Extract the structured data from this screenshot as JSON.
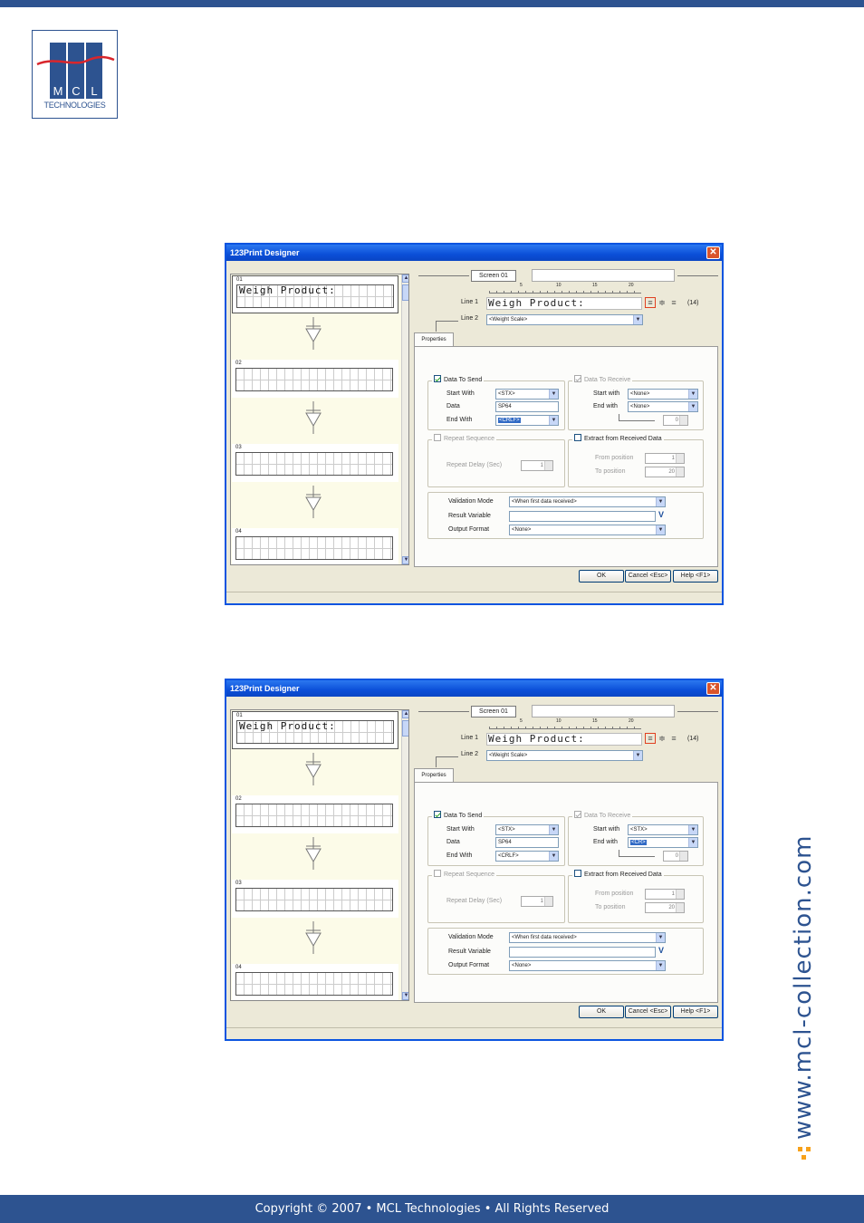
{
  "header": {
    "bar_color": "#2d5390"
  },
  "logo": {
    "letters": "M C L",
    "sub": "TECHNOLOGIES"
  },
  "side_url": "www.mcl-collection.com",
  "footer": {
    "text": "Copyright © 2007 • MCL Technologies • All Rights Reserved"
  },
  "windows": [
    {
      "title": "123Print Designer",
      "screens": [
        {
          "num": "01",
          "text": "Weigh Product:"
        },
        {
          "num": "02",
          "text": ""
        },
        {
          "num": "03",
          "text": ""
        },
        {
          "num": "04",
          "text": ""
        }
      ],
      "screen_btn": "Screen 01",
      "ruler": [
        "5",
        "10",
        "15",
        "20"
      ],
      "line1_label": "Line 1",
      "line1_value": "Weigh Product:",
      "line1_count": "(14)",
      "line2_label": "Line 2",
      "line2_value": "<Weight Scale>",
      "tab": "Properties",
      "send": {
        "title": "Data To Send",
        "start_label": "Start With",
        "start_value": "<STX>",
        "data_label": "Data",
        "data_value": "SP64",
        "end_label": "End With",
        "end_value": "<CRLF>",
        "end_highlight": true
      },
      "receive": {
        "title": "Data To Receive",
        "start_label": "Start with",
        "start_value": "<None>",
        "end_label": "End with",
        "end_value": "<None>",
        "end_highlight": false,
        "spin": "0"
      },
      "repeat": {
        "title": "Repeat Sequence",
        "delay_label": "Repeat Delay (Sec)",
        "delay_value": "1"
      },
      "extract": {
        "title": "Extract from Received Data",
        "from_label": "From position",
        "from_value": "1",
        "to_label": "To position",
        "to_value": "20"
      },
      "validation": {
        "mode_label": "Validation Mode",
        "mode_value": "<When first data received>",
        "result_label": "Result Variable",
        "result_value": "",
        "output_label": "Output Format",
        "output_value": "<None>"
      },
      "buttons": {
        "ok": "OK",
        "cancel": "Cancel <Esc>",
        "help": "Help <F1>"
      }
    },
    {
      "title": "123Print Designer",
      "screens": [
        {
          "num": "01",
          "text": "Weigh Product:"
        },
        {
          "num": "02",
          "text": ""
        },
        {
          "num": "03",
          "text": ""
        },
        {
          "num": "04",
          "text": ""
        }
      ],
      "screen_btn": "Screen 01",
      "ruler": [
        "5",
        "10",
        "15",
        "20"
      ],
      "line1_label": "Line 1",
      "line1_value": "Weigh Product:",
      "line1_count": "(14)",
      "line2_label": "Line 2",
      "line2_value": "<Weight Scale>",
      "tab": "Properties",
      "send": {
        "title": "Data To Send",
        "start_label": "Start With",
        "start_value": "<STX>",
        "data_label": "Data",
        "data_value": "SP64",
        "end_label": "End With",
        "end_value": "<CRLF>",
        "end_highlight": false
      },
      "receive": {
        "title": "Data To Receive",
        "start_label": "Start with",
        "start_value": "<STX>",
        "end_label": "End with",
        "end_value": "<CR>",
        "end_highlight": true,
        "spin": "0"
      },
      "repeat": {
        "title": "Repeat Sequence",
        "delay_label": "Repeat Delay (Sec)",
        "delay_value": "1"
      },
      "extract": {
        "title": "Extract from Received Data",
        "from_label": "From position",
        "from_value": "1",
        "to_label": "To position",
        "to_value": "20"
      },
      "validation": {
        "mode_label": "Validation Mode",
        "mode_value": "<When first data received>",
        "result_label": "Result Variable",
        "result_value": "",
        "output_label": "Output Format",
        "output_value": "<None>"
      },
      "buttons": {
        "ok": "OK",
        "cancel": "Cancel <Esc>",
        "help": "Help <F1>"
      }
    }
  ]
}
